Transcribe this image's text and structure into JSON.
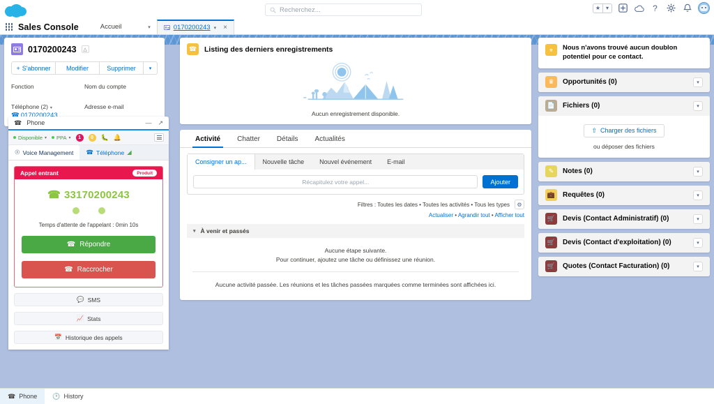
{
  "global_header": {
    "logo_icon": "salesforce-cloud-logo",
    "search": {
      "placeholder": "Recherchez...",
      "icon": "search-icon"
    },
    "actions": [
      {
        "name": "favorites-star",
        "icon": "star-icon",
        "glyph": "★"
      },
      {
        "name": "favorites-caret",
        "icon": "chevron-down-icon",
        "glyph": "▾"
      },
      {
        "name": "add-item",
        "icon": "plus-square-icon"
      },
      {
        "name": "app-launcher-cloud",
        "icon": "cloud-icon"
      },
      {
        "name": "help",
        "icon": "question-icon",
        "glyph": "?"
      },
      {
        "name": "setup",
        "icon": "gear-icon"
      },
      {
        "name": "notifications",
        "icon": "bell-icon"
      },
      {
        "name": "user-avatar",
        "icon": "avatar-icon"
      }
    ]
  },
  "app_nav": {
    "waffle_icon": "app-launcher-icon",
    "app_name": "Sales Console",
    "tabs": [
      {
        "label": "Accueil",
        "active": false,
        "has_caret": true,
        "icon": null
      },
      {
        "label": "0170200243",
        "active": true,
        "has_caret": true,
        "icon": "contact-card-icon",
        "closable": true
      }
    ]
  },
  "contact": {
    "avatar_icon": "contact-avatar-icon",
    "name": "0170200243",
    "badge_icon": "hierarchy-icon",
    "buttons": [
      {
        "label": "S'abonner",
        "icon": "plus-icon"
      },
      {
        "label": "Modifier",
        "icon": null
      },
      {
        "label": "Supprimer",
        "icon": null
      },
      {
        "label": "",
        "icon": "chevron-down-icon"
      }
    ],
    "fields": [
      {
        "label": "Fonction",
        "value": ""
      },
      {
        "label": "Nom du compte",
        "value": ""
      },
      {
        "label": "Téléphone (2)",
        "value": "0170200243",
        "has_caret": true,
        "icon": "phone-icon"
      },
      {
        "label": "Adresse e-mail",
        "value": ""
      }
    ]
  },
  "phone_widget": {
    "header_title": "Phone",
    "header_icon": "phone-icon",
    "minimize_icon": "minimize-icon",
    "popout_icon": "popout-icon",
    "status_bar": {
      "presence": "Disponible",
      "queue": "PPA",
      "badge_red": "1",
      "badge_yellow": "0",
      "bug_icon": "bug-icon",
      "bell_icon": "bell-icon",
      "menu_icon": "hamburger-icon"
    },
    "tabs": [
      {
        "label": "Voice Management",
        "icon": "headset-icon",
        "active": true
      },
      {
        "label": "Téléphone",
        "icon": "phone-icon",
        "suffix_icon": "wifi-icon",
        "active": false
      }
    ],
    "call": {
      "header_label": "Appel entrant",
      "tag": "Produit",
      "number": "33170200243",
      "number_icon": "phone-icon",
      "wait_label": "Temps d'attente de l'appelant : 0min 10s",
      "answer_label": "Répondre",
      "answer_icon": "phone-icon",
      "hangup_label": "Raccrocher",
      "hangup_icon": "phone-hangup-icon",
      "header_color": "#e8184e",
      "answer_color": "#4aa845",
      "hangup_color": "#d9534f",
      "number_color": "#8cc63f"
    },
    "utility_buttons": [
      {
        "label": "SMS",
        "icon": "chat-bubble-icon"
      },
      {
        "label": "Stats",
        "icon": "chart-line-icon"
      },
      {
        "label": "Historique des appels",
        "icon": "calendar-icon"
      }
    ]
  },
  "recordings_card": {
    "icon": "phone-call-icon",
    "icon_color": "#f5c13e",
    "title": "Listing des derniers enregistrements",
    "illustration": "desert-camping-illustration",
    "empty_text": "Aucun enregistrement disponible."
  },
  "main_tabs": [
    {
      "label": "Activité",
      "active": true
    },
    {
      "label": "Chatter",
      "active": false
    },
    {
      "label": "Détails",
      "active": false
    },
    {
      "label": "Actualités",
      "active": false
    }
  ],
  "publisher": {
    "tabs": [
      {
        "label": "Consigner un ap...",
        "active": true
      },
      {
        "label": "Nouvelle tâche",
        "active": false
      },
      {
        "label": "Nouvel événement",
        "active": false
      },
      {
        "label": "E-mail",
        "active": false
      }
    ],
    "input_placeholder": "Récapitulez votre appel...",
    "submit_label": "Ajouter"
  },
  "activity": {
    "filters_label": "Filtres : Toutes les dates • Toutes les activités • Tous les types",
    "gear_icon": "gear-icon",
    "links": [
      "Actualiser",
      "Agrandir tout",
      "Afficher tout"
    ],
    "link_separator": "•",
    "section_title": "À venir et passés",
    "section_chevron": "chevron-down-icon",
    "empty_line1": "Aucune étape suivante.",
    "empty_line2": "Pour continuer, ajoutez une tâche ou définissez une réunion.",
    "empty_past": "Aucune activité passée. Les réunions et les tâches passées marquées comme terminées sont affichées ici."
  },
  "right_panels": {
    "duplicate_notice": {
      "icon": "merge-contacts-icon",
      "icon_color": "#f5c13e",
      "text": "Nous n'avons trouvé aucun doublon potentiel pour ce contact."
    },
    "panels": [
      {
        "title": "Opportunités (0)",
        "icon": "opportunity-crown-icon",
        "icon_color": "#fcb95b",
        "expandable": true
      },
      {
        "title": "Fichiers (0)",
        "icon": "file-icon",
        "icon_color": "#baac93",
        "expandable": true,
        "body": {
          "upload_label": "Charger des fichiers",
          "upload_icon": "upload-icon",
          "hint": "ou déposer des fichiers"
        }
      },
      {
        "title": "Notes (0)",
        "icon": "note-icon",
        "icon_color": "#e6d75c",
        "expandable": true
      },
      {
        "title": "Requêtes (0)",
        "icon": "case-briefcase-icon",
        "icon_color": "#f2cf5b",
        "expandable": true
      },
      {
        "title": "Devis (Contact Administratif) (0)",
        "icon": "quote-cart-icon",
        "icon_color": "#8c3c3c",
        "expandable": true
      },
      {
        "title": "Devis (Contact d'exploitation) (0)",
        "icon": "quote-cart-icon",
        "icon_color": "#8c3c3c",
        "expandable": true
      },
      {
        "title": "Quotes (Contact Facturation) (0)",
        "icon": "quote-cart-icon",
        "icon_color": "#8c3c3c",
        "expandable": true
      }
    ]
  },
  "utility_bar": [
    {
      "label": "Phone",
      "icon": "phone-icon",
      "active": true
    },
    {
      "label": "History",
      "icon": "clock-icon",
      "active": false
    }
  ]
}
